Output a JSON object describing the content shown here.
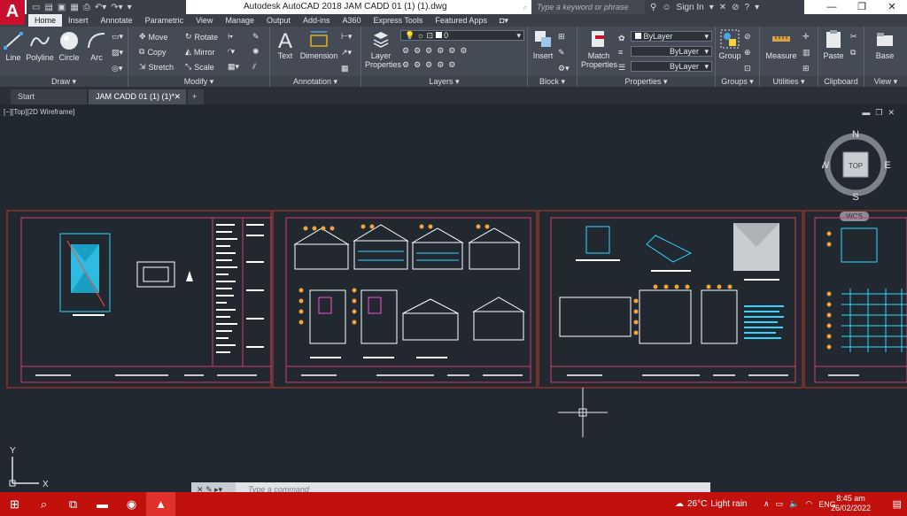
{
  "app": {
    "logo": "A",
    "title": "Autodesk AutoCAD 2018    JAM CADD 01 (1) (1).dwg",
    "search_placeholder": "Type a keyword or phrase",
    "sign_in": "Sign In"
  },
  "ribbon_tabs": [
    "Home",
    "Insert",
    "Annotate",
    "Parametric",
    "View",
    "Manage",
    "Output",
    "Add-ins",
    "A360",
    "Express Tools",
    "Featured Apps"
  ],
  "active_tab": "Home",
  "draw_panel": {
    "title": "Draw",
    "tools": [
      "Line",
      "Polyline",
      "Circle",
      "Arc"
    ]
  },
  "modify_panel": {
    "title": "Modify",
    "tools": [
      "Move",
      "Rotate",
      "Copy",
      "Mirror",
      "Stretch",
      "Scale"
    ]
  },
  "annotation_panel": {
    "title": "Annotation",
    "tools": [
      "Text",
      "Dimension"
    ]
  },
  "layers_panel": {
    "title": "Layers",
    "layer_properties": "Layer Properties",
    "current_layer": "0"
  },
  "block_panel": {
    "title": "Block",
    "insert": "Insert"
  },
  "properties_panel": {
    "title": "Properties",
    "match_properties": "Match Properties",
    "color": "ByLayer",
    "linetype": "ByLayer",
    "lineweight": "ByLayer"
  },
  "groups_panel": {
    "title": "Groups",
    "group": "Group"
  },
  "utilities_panel": {
    "title": "Utilities",
    "measure": "Measure"
  },
  "clipboard_panel": {
    "title": "Clipboard",
    "paste": "Paste"
  },
  "view_panel": {
    "title": "View",
    "base": "Base"
  },
  "doc_tabs": [
    {
      "label": "Start"
    },
    {
      "label": "JAM CADD 01 (1) (1)*"
    }
  ],
  "viewport": {
    "label": "[−][Top][2D Wireframe]",
    "viewcube": {
      "n": "N",
      "s": "S",
      "e": "E",
      "w": "W",
      "face": "TOP"
    },
    "wcs": "WCS",
    "ucs_x": "X",
    "ucs_y": "Y"
  },
  "command_line": {
    "placeholder": "Type a command"
  },
  "taskbar": {
    "weather_temp": "26°C",
    "weather_text": "Light rain",
    "language": "ENG",
    "time": "8:45 am",
    "date": "26/02/2022"
  },
  "colors": {
    "background": "#212830",
    "sheet_border": "#c0392b",
    "taskbar": "#c2110d",
    "cyan_drawing": "#2fd6ff",
    "accent_logo": "#c8102e"
  }
}
